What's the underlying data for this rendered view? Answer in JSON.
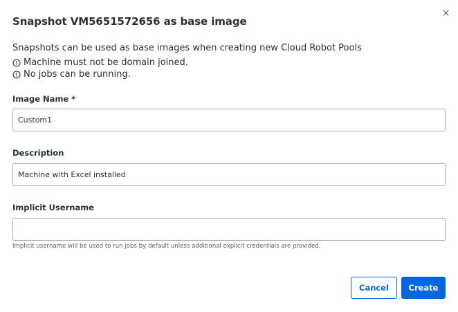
{
  "dialog": {
    "title": "Snapshot VM5651572656 as base image",
    "close_icon": "close-icon",
    "intro": "Snapshots can be used as base images when creating new Cloud Robot Pools",
    "notes": [
      {
        "icon": "info-icon",
        "text": "Machine must not be domain joined."
      },
      {
        "icon": "info-icon",
        "text": "No jobs can be running."
      }
    ]
  },
  "form": {
    "image_name": {
      "label": "Image Name *",
      "value": "Custom1"
    },
    "description": {
      "label": "Description",
      "value": "Machine with Excel installed"
    },
    "implicit_username": {
      "label": "Implicit Username",
      "value": "",
      "helper": "Implicit username will be used to run jobs by default unless additional explicit credentials are provided."
    }
  },
  "actions": {
    "cancel_label": "Cancel",
    "create_label": "Create"
  },
  "colors": {
    "primary": "#0067df",
    "text": "#273139",
    "border": "#a4b1b8",
    "muted": "#526069"
  }
}
